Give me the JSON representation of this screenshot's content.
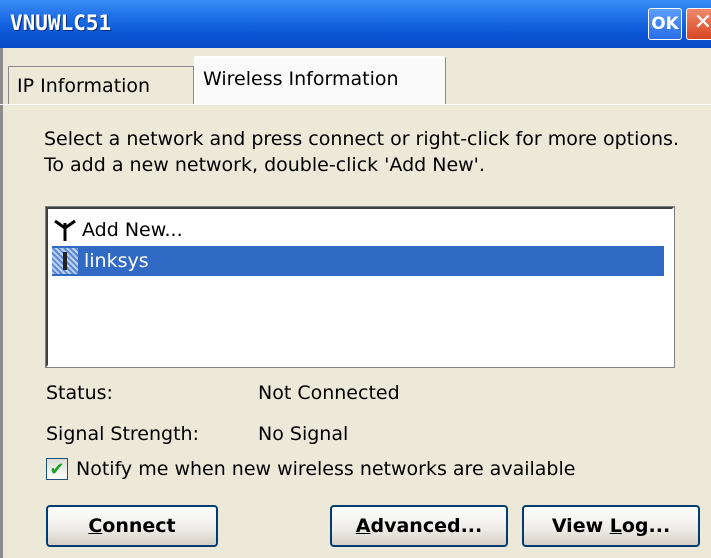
{
  "window": {
    "title": "VNUWLC51",
    "ok_label": "OK",
    "close_label": "✕"
  },
  "tabs": [
    {
      "label": "IP Information",
      "selected": false
    },
    {
      "label": "Wireless Information",
      "selected": true
    }
  ],
  "instructions": "Select a network and press connect or right-click for more options.  To add a new network, double-click 'Add New'.",
  "networks": [
    {
      "label": "Add New...",
      "icon": "antenna-icon",
      "selected": false
    },
    {
      "label": "linksys",
      "icon": "signal-icon",
      "selected": true
    }
  ],
  "status": {
    "status_label": "Status:",
    "status_value": "Not Connected",
    "signal_label": "Signal Strength:",
    "signal_value": "No Signal"
  },
  "notify": {
    "label": "Notify me when new wireless networks are available",
    "checked": true
  },
  "buttons": {
    "connect_rest": "onnect",
    "connect_key": "C",
    "advanced_key": "A",
    "advanced_rest": "dvanced...",
    "viewlog_pre": "View ",
    "viewlog_key": "L",
    "viewlog_rest": "og..."
  },
  "colors": {
    "titlebar": "#0a56d8",
    "selection": "#316ac5",
    "face": "#ece9d8"
  }
}
